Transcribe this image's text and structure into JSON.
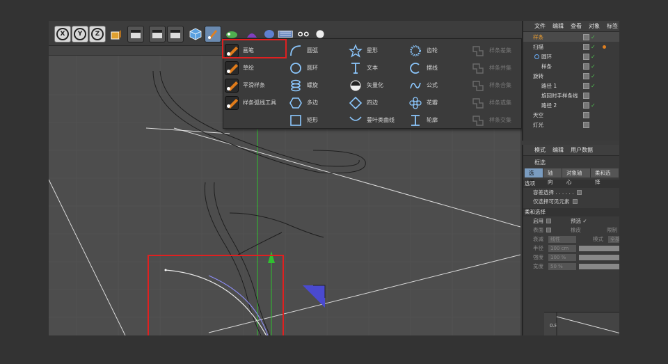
{
  "toolbar": {
    "axis_buttons": [
      "X",
      "Y",
      "Z"
    ],
    "icons": [
      "lock-axis-icon",
      "render-view-icon",
      "render-settings-icon",
      "render-picture-viewer-icon",
      "cube-icon",
      "pen-icon",
      "nurbs-icon",
      "deformer-icon",
      "environment-icon",
      "camera-icon",
      "light-icon"
    ]
  },
  "spline_palette": {
    "columns": [
      [
        {
          "label": "画笔",
          "icon": "pen-icon"
        },
        {
          "label": "草绘",
          "icon": "sketch-icon"
        },
        {
          "label": "平滑样条",
          "icon": "smooth-spline-icon"
        },
        {
          "label": "样条弧线工具",
          "icon": "spline-arc-icon"
        }
      ],
      [
        {
          "label": "圆弧",
          "icon": "arc-icon"
        },
        {
          "label": "圆环",
          "icon": "circle-icon"
        },
        {
          "label": "螺旋",
          "icon": "helix-icon"
        },
        {
          "label": "多边",
          "icon": "polygon-icon"
        },
        {
          "label": "矩形",
          "icon": "rectangle-icon"
        }
      ],
      [
        {
          "label": "星形",
          "icon": "star-icon"
        },
        {
          "label": "文本",
          "icon": "text-icon"
        },
        {
          "label": "矢量化",
          "icon": "vectorizer-icon"
        },
        {
          "label": "四边",
          "icon": "four-side-icon"
        },
        {
          "label": "蔓叶类曲线",
          "icon": "cissoid-icon"
        }
      ],
      [
        {
          "label": "齿轮",
          "icon": "cogwheel-icon"
        },
        {
          "label": "摆线",
          "icon": "cycloid-icon"
        },
        {
          "label": "公式",
          "icon": "formula-icon"
        },
        {
          "label": "花瓣",
          "icon": "flower-icon"
        },
        {
          "label": "轮廓",
          "icon": "profile-icon"
        }
      ],
      [
        {
          "label": "样条差集",
          "icon": "spline-subtract-icon"
        },
        {
          "label": "样条并集",
          "icon": "spline-union-icon"
        },
        {
          "label": "样条合集",
          "icon": "spline-and-icon"
        },
        {
          "label": "样条或集",
          "icon": "spline-or-icon"
        },
        {
          "label": "样条交集",
          "icon": "spline-intersect-icon"
        }
      ]
    ]
  },
  "object_manager": {
    "menu": [
      "文件",
      "编辑",
      "查看",
      "对象",
      "标签"
    ],
    "items": [
      {
        "name": "样条",
        "selected": true,
        "indent": 0,
        "checked": true
      },
      {
        "name": "扫描",
        "selected": false,
        "indent": 0,
        "checked": true
      },
      {
        "name": "圆环",
        "selected": false,
        "indent": 1,
        "checked": true
      },
      {
        "name": "样条",
        "selected": false,
        "indent": 1,
        "checked": true
      },
      {
        "name": "旋转",
        "selected": false,
        "indent": 0,
        "checked": true
      },
      {
        "name": "路径 1",
        "selected": false,
        "indent": 1,
        "checked": true
      },
      {
        "name": "旋回时手样条线",
        "selected": false,
        "indent": 1,
        "checked": false
      },
      {
        "name": "路径 2",
        "selected": false,
        "indent": 1,
        "checked": true
      },
      {
        "name": "天空",
        "selected": false,
        "indent": 0,
        "checked": false
      },
      {
        "name": "灯光",
        "selected": false,
        "indent": 0,
        "checked": false
      }
    ]
  },
  "attribute_manager": {
    "menu": [
      "模式",
      "编辑",
      "用户数据"
    ],
    "title": "框选",
    "tabs": [
      "选项",
      "轴向",
      "对象轴心",
      "柔和选择"
    ],
    "options_section": "选项",
    "options": [
      {
        "label": "容差选择 . . . . . .",
        "checkbox": true
      },
      {
        "label": "仅选择可见元素",
        "checkbox": true
      }
    ],
    "soft_section": "柔和选择",
    "soft_rows": [
      {
        "label": "启用",
        "extra": "预选 ✓"
      },
      {
        "label": "表面",
        "extra": "橡皮"
      },
      {
        "label": "衰减",
        "value": "线性",
        "extra": "模式"
      },
      {
        "label": "半径",
        "value": "100 cm"
      },
      {
        "label": "强度",
        "value": "100 %"
      },
      {
        "label": "宽度",
        "value": "50 %"
      }
    ],
    "soft_extra_right": "限制",
    "mode_value": "全部",
    "graph_label": "0.8"
  },
  "colors": {
    "accent_red": "#e02020",
    "selected_orange": "#f0a030",
    "active_tab": "#7a9cc0",
    "axis_green": "#30c030",
    "axis_red": "#e03030",
    "axis_blue": "#4040c0"
  }
}
